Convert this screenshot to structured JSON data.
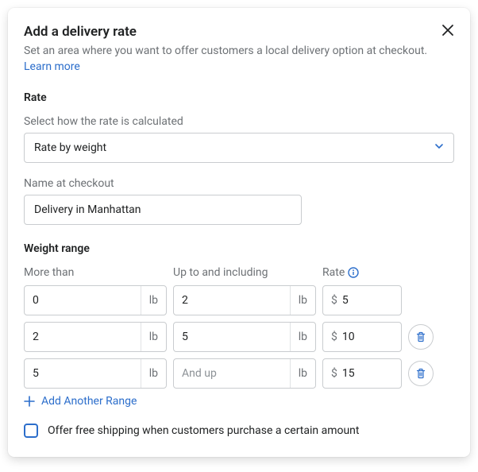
{
  "header": {
    "title": "Add a delivery rate",
    "subtitle_prefix": "Set an area where you want to offer customers a local delivery option at checkout. ",
    "learn_more": "Learn more"
  },
  "rate_section": {
    "label": "Rate",
    "calc_label": "Select how the rate is calculated",
    "calc_value": "Rate by weight",
    "name_label": "Name at checkout",
    "name_value": "Delivery in Manhattan"
  },
  "weight_section": {
    "label": "Weight range",
    "headers": {
      "more_than": "More than",
      "up_to": "Up to and including",
      "rate": "Rate"
    },
    "unit": "lb",
    "currency": "$",
    "and_up": "And up",
    "rows": [
      {
        "from": "0",
        "to": "2",
        "rate": "5",
        "deletable": false
      },
      {
        "from": "2",
        "to": "5",
        "rate": "10",
        "deletable": true
      },
      {
        "from": "5",
        "to": "",
        "rate": "15",
        "deletable": true
      }
    ],
    "add_label": "Add Another Range"
  },
  "free_shipping": {
    "label": "Offer free shipping when customers purchase a certain amount",
    "checked": false
  }
}
